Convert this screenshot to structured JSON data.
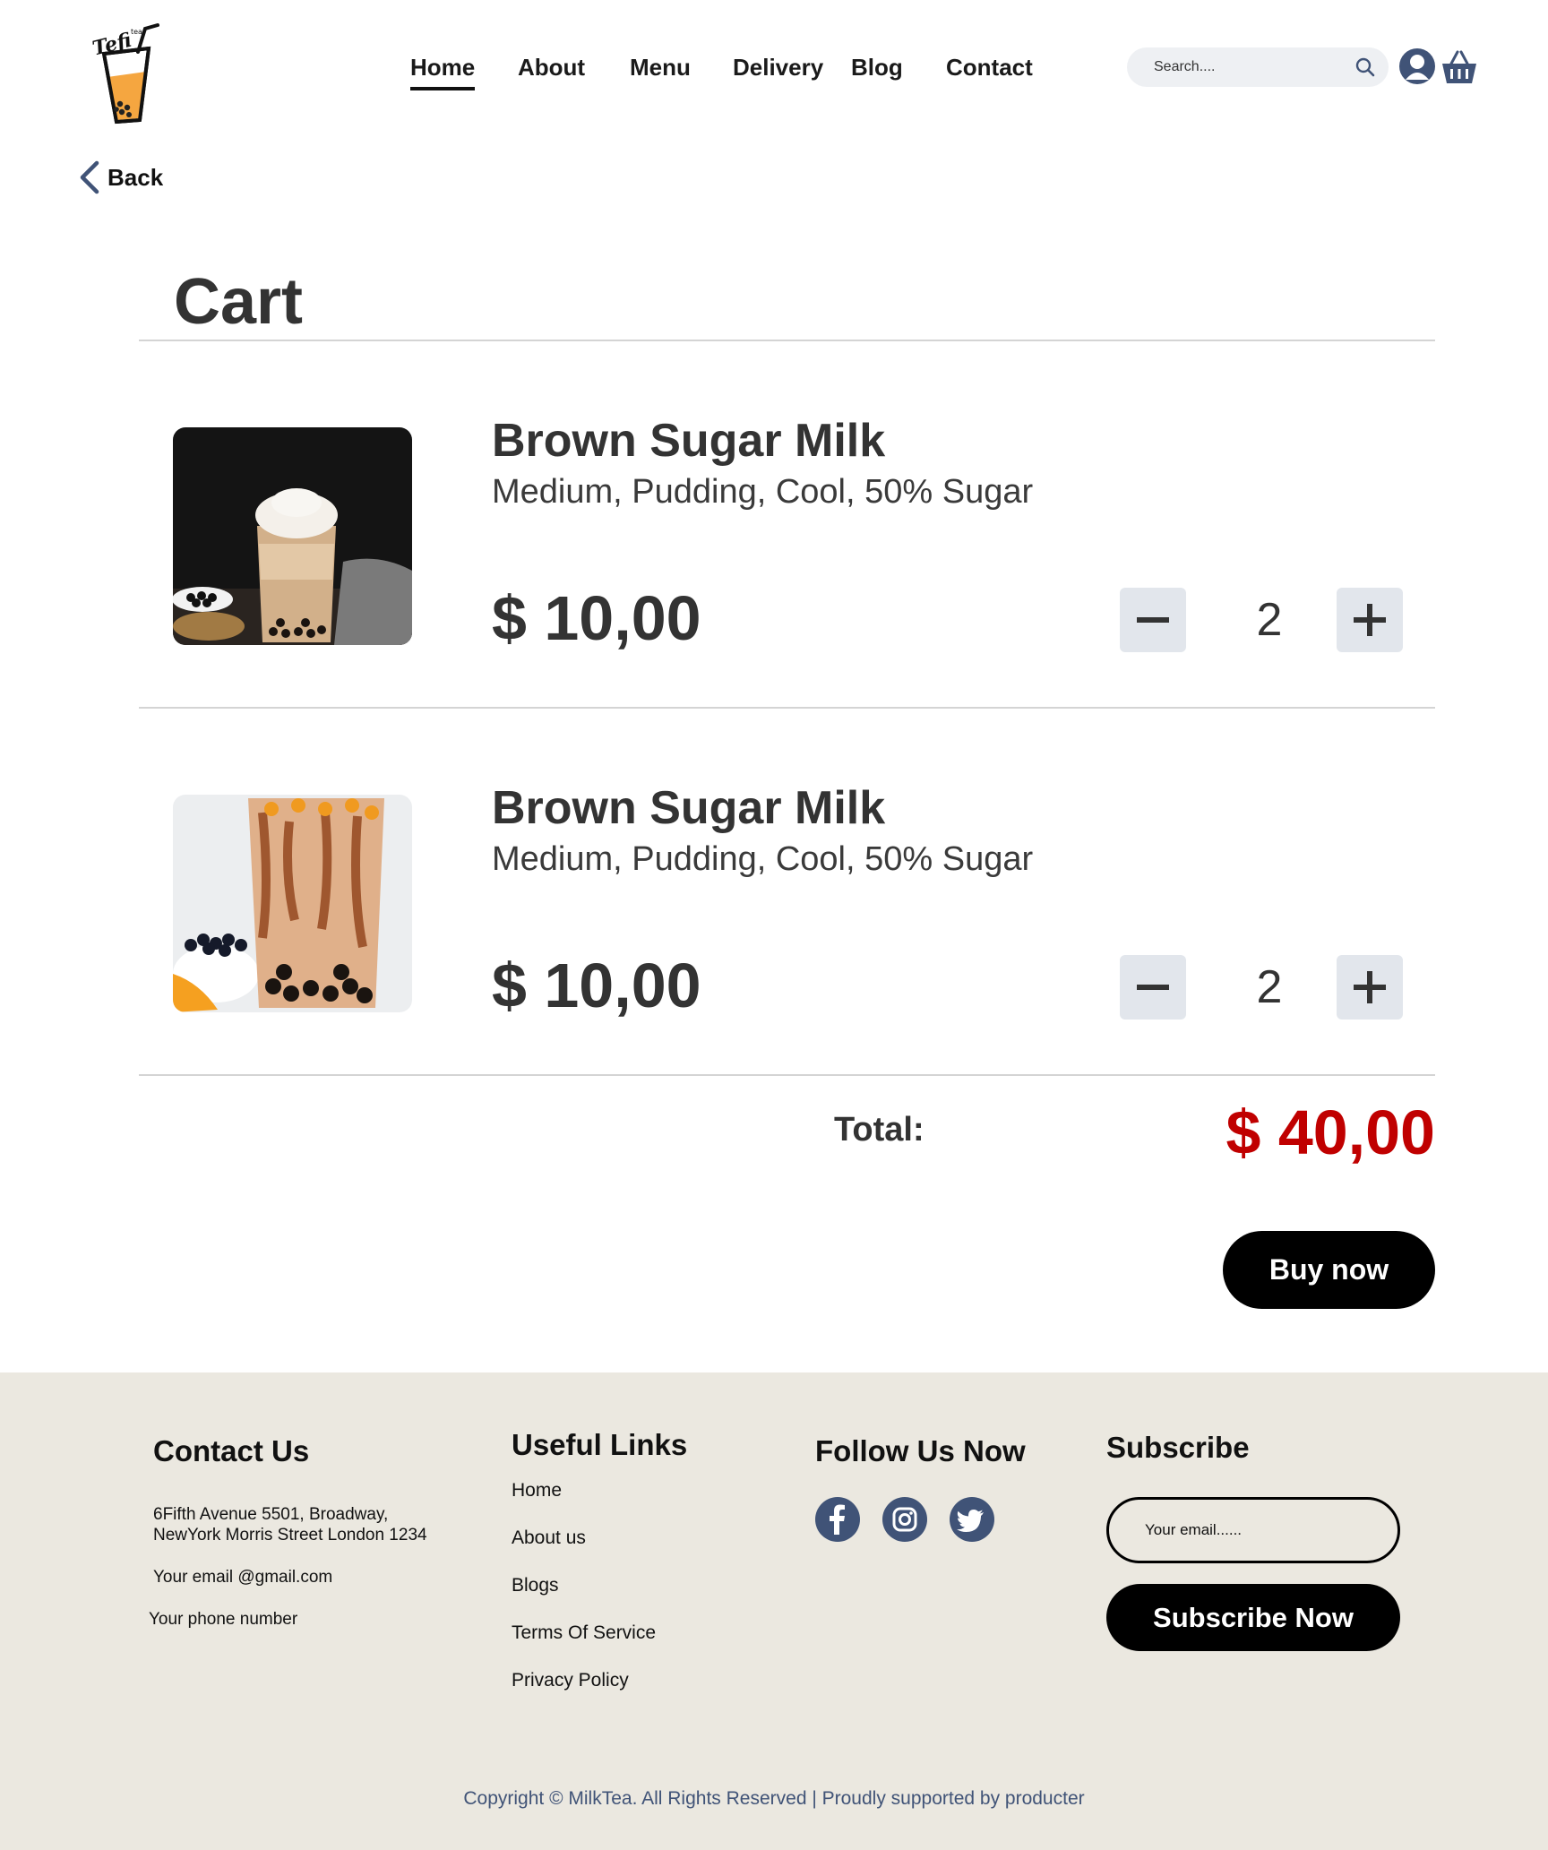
{
  "header": {
    "nav": [
      {
        "label": "Home",
        "active": true
      },
      {
        "label": "About"
      },
      {
        "label": "Menu"
      },
      {
        "label": "Delivery"
      },
      {
        "label": "Blog"
      },
      {
        "label": "Contact"
      }
    ],
    "search_placeholder": "Search....",
    "icons": [
      "logo-icon",
      "search-icon",
      "user-icon",
      "cart-icon"
    ]
  },
  "back_label": "Back",
  "cart": {
    "title": "Cart",
    "items": [
      {
        "name": "Brown Sugar Milk",
        "options": "Medium, Pudding, Cool, 50% Sugar",
        "price": "$ 10,00",
        "quantity": "2"
      },
      {
        "name": "Brown Sugar Milk",
        "options": "Medium, Pudding, Cool, 50% Sugar",
        "price": "$ 10,00",
        "quantity": "2"
      }
    ],
    "total_label": "Total:",
    "total_value": "$ 40,00",
    "buy_label": "Buy now"
  },
  "footer": {
    "contact": {
      "heading": "Contact Us",
      "address_line1": "6Fifth Avenue 5501, Broadway,",
      "address_line2": "NewYork Morris Street London 1234",
      "email": "Your email @gmail.com",
      "phone": "Your phone number"
    },
    "links": {
      "heading": "Useful Links",
      "items": [
        "Home",
        "About us",
        "Blogs",
        "Terms Of Service",
        "Privacy Policy"
      ]
    },
    "follow": {
      "heading": "Follow Us Now",
      "icons": [
        "facebook-icon",
        "instagram-icon",
        "twitter-icon"
      ]
    },
    "subscribe": {
      "heading": "Subscribe",
      "placeholder": "Your email......",
      "button_label": "Subscribe Now"
    },
    "copyright": "Copyright © MilkTea. All Rights Reserved | Proudly supported by producter"
  },
  "colors": {
    "accent_total": "#c00000",
    "icon_blue": "#405377",
    "footer_bg": "#ebe8e0",
    "qty_button_bg": "#e2e6ec"
  }
}
